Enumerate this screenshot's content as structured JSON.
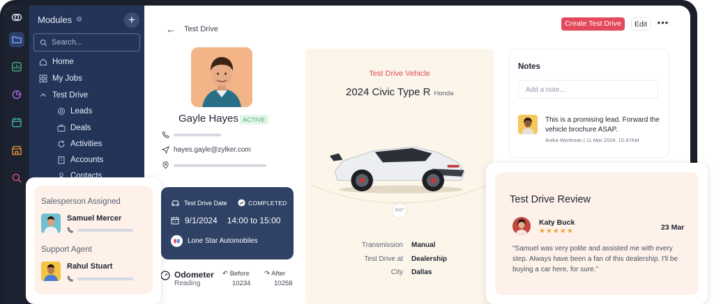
{
  "sidebar": {
    "title": "Modules",
    "search_placeholder": "Search...",
    "items": [
      {
        "label": "Home",
        "icon": "home-icon"
      },
      {
        "label": "My Jobs",
        "icon": "grid-icon"
      },
      {
        "label": "Test Drive",
        "icon": "chevron-icon"
      },
      {
        "label": "Leads",
        "icon": "target-icon"
      },
      {
        "label": "Deals",
        "icon": "briefcase-icon"
      },
      {
        "label": "Activities",
        "icon": "refresh-icon"
      },
      {
        "label": "Accounts",
        "icon": "building-icon"
      },
      {
        "label": "Contacts",
        "icon": "user-icon"
      }
    ]
  },
  "header": {
    "title": "Test Drive",
    "create_label": "Create Test Drive",
    "edit_label": "Edit",
    "more_label": "•••"
  },
  "profile": {
    "name": "Gayle Hayes",
    "status": "ACTIVE",
    "email": "hayes.gayle@zylker.com"
  },
  "test_drive_card": {
    "label": "Test Drive Date",
    "status": "COMPLETED",
    "date": "9/1/2024",
    "time": "14:00 to 15:00",
    "dealer": "Lone Star Automobiles"
  },
  "odometer": {
    "title": "Odometer",
    "subtitle": "Reading",
    "before_label": "Before",
    "before_value": "10234",
    "after_label": "After",
    "after_value": "10258"
  },
  "vehicle": {
    "label": "Test Drive Vehicle",
    "model": "2024 Civic Type R",
    "make": "Honda",
    "specs": [
      {
        "key": "Transmission",
        "value": "Manual"
      },
      {
        "key": "Test Drive at",
        "value": "Dealership"
      },
      {
        "key": "City",
        "value": "Dallas"
      }
    ]
  },
  "notes": {
    "title": "Notes",
    "placeholder": "Add a note...",
    "entry_text": "This is a promising lead. Forward the vehicle brochure ASAP.",
    "entry_meta": "Anika Workman | 11 Mar 2024, 10.47AM"
  },
  "sales_card": {
    "salesperson_heading": "Salesperson Assigned",
    "salesperson_name": "Samuel Mercer",
    "agent_heading": "Support Agent",
    "agent_name": "Rahul Stuart"
  },
  "review": {
    "title": "Test Drive Review",
    "reviewer": "Katy Buck",
    "stars": "★★★★★",
    "date": "23 Mar",
    "text": "\"Samuel was very polite and assisted me with every step. Always have been a fan of this dealership. I'll be buying a car here, for sure.\""
  },
  "colors": {
    "sidebar_bg": "#243459",
    "accent_red": "#e3495a",
    "card_navy": "#2f4266",
    "active_green": "#3aa66b",
    "cream_panel": "#fcf6ea",
    "peach_panel": "#fdf1e9",
    "star_orange": "#f0a232"
  }
}
